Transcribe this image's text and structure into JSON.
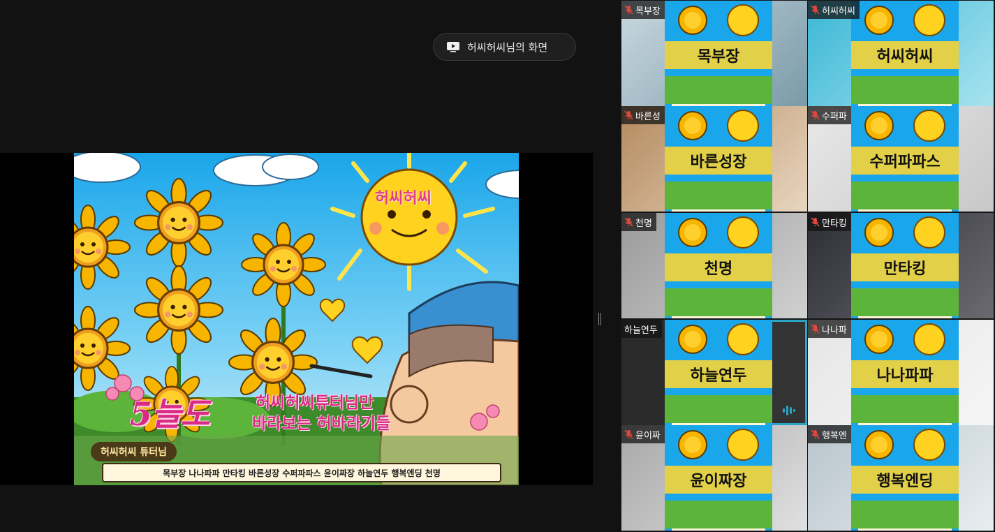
{
  "share": {
    "pill_label": "허씨허씨님의 화면"
  },
  "slide": {
    "sun_name": "허씨허씨",
    "slogan_big": "5늘도",
    "slogan_line1": "허씨허씨튜터님만",
    "slogan_line2": "바라보는 허바라기들",
    "tutor_badge": "허씨허씨 튜터님",
    "member_banner": "목부장 나나파파 만타킹 바른성장 수퍼파파스 윤이짜장 하늘연두 행복엔딩 천명"
  },
  "participants": [
    {
      "tag": "목부장",
      "overlay": "목부장",
      "muted": true
    },
    {
      "tag": "허씨허씨",
      "overlay": "허씨허씨",
      "muted": true
    },
    {
      "tag": "바른성",
      "overlay": "바른성장",
      "muted": true
    },
    {
      "tag": "수퍼파",
      "overlay": "수퍼파파스",
      "muted": true
    },
    {
      "tag": "천명",
      "overlay": "천명",
      "muted": true
    },
    {
      "tag": "만타킹",
      "overlay": "만타킹",
      "muted": true
    },
    {
      "tag": "하늘연두",
      "overlay": "하늘연두",
      "muted": false,
      "speaking": true
    },
    {
      "tag": "나나파",
      "overlay": "나나파파",
      "muted": true
    },
    {
      "tag": "윤이짜",
      "overlay": "윤이짜장",
      "muted": true
    },
    {
      "tag": "행복엔",
      "overlay": "행복엔딩",
      "muted": true
    }
  ],
  "colors": {
    "background": "#121212",
    "speaker_border": "#2ecc40",
    "mic_off": "#e0483e",
    "overlay_yellow": "#f2d43a",
    "slogan_pink": "#d92b84"
  }
}
